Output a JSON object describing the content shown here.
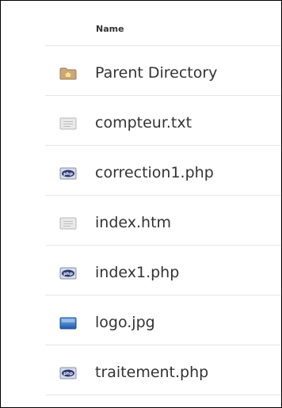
{
  "listing": {
    "column_header": "Name",
    "rows": [
      {
        "name": "Parent Directory",
        "icon": "folder-icon"
      },
      {
        "name": "compteur.txt",
        "icon": "text-file-icon"
      },
      {
        "name": "correction1.php",
        "icon": "php-file-icon"
      },
      {
        "name": "index.htm",
        "icon": "text-file-icon"
      },
      {
        "name": "index1.php",
        "icon": "php-file-icon"
      },
      {
        "name": "logo.jpg",
        "icon": "image-file-icon"
      },
      {
        "name": "traitement.php",
        "icon": "php-file-icon"
      }
    ]
  },
  "colors": {
    "text": "#333333",
    "row_divider": "#e6e6e6",
    "frame_border": "#000000",
    "folder": "#c9a97a",
    "php_badge": "#2b3a78",
    "image_blue": "#2f6fc2"
  }
}
